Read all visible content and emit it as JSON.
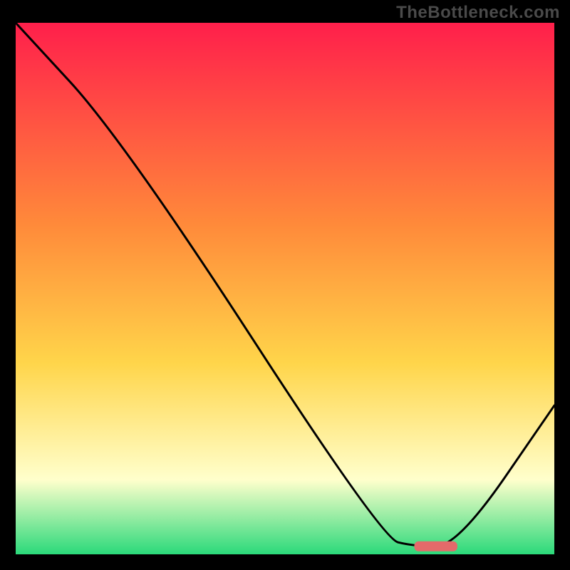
{
  "watermark": "TheBottleneck.com",
  "colors": {
    "top": "#ff1f4b",
    "mid1": "#ff8a3a",
    "mid2": "#ffd54a",
    "pale": "#ffffcc",
    "green": "#2bd97a",
    "line": "#000000",
    "marker": "#e46a6a"
  },
  "chart_data": {
    "type": "line",
    "title": "",
    "xlabel": "",
    "ylabel": "",
    "x_range": [
      0,
      100
    ],
    "y_range": [
      0,
      100
    ],
    "series": [
      {
        "name": "bottleneck-curve",
        "x": [
          0,
          20,
          68,
          74,
          82,
          100
        ],
        "y": [
          100,
          78,
          3,
          1.5,
          1.5,
          28
        ]
      }
    ],
    "marker": {
      "name": "optimal-range",
      "x_start": 74,
      "x_end": 82,
      "y": 1.5
    },
    "gradient_stops": [
      {
        "pct": 0,
        "color": "#ff1f4b"
      },
      {
        "pct": 38,
        "color": "#ff8a3a"
      },
      {
        "pct": 64,
        "color": "#ffd54a"
      },
      {
        "pct": 86,
        "color": "#ffffcc"
      },
      {
        "pct": 100,
        "color": "#2bd97a"
      }
    ]
  }
}
